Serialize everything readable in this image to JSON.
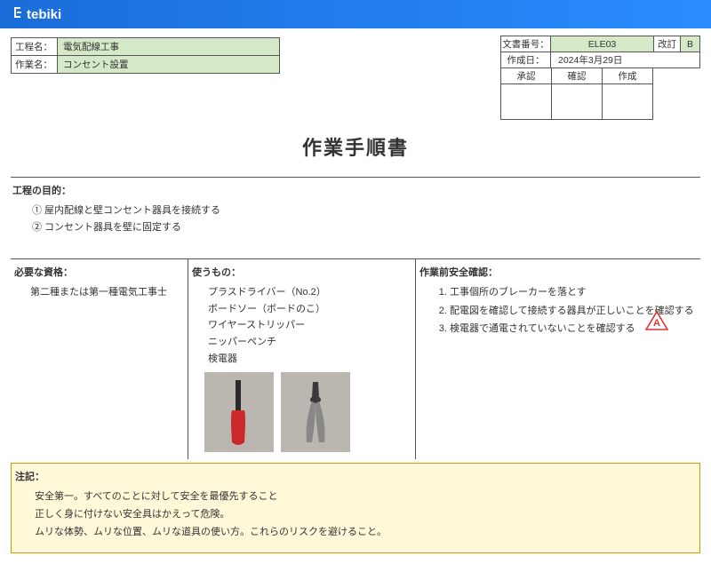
{
  "brand": "tebiki",
  "meta": {
    "doc_no_label": "文書番号：",
    "doc_no": "ELE03",
    "rev_label": "改訂",
    "rev": "B",
    "date_label": "作成日：",
    "date": "2024年3月29日",
    "approve": "承認",
    "check": "確認",
    "create": "作成"
  },
  "header": {
    "proc_label": "工程名：",
    "proc": "電気配線工事",
    "task_label": "作業名：",
    "task": "コンセント設置"
  },
  "title": "作業手順書",
  "purpose": {
    "label": "工程の目的：",
    "line1": "① 屋内配線と壁コンセント器具を接続する",
    "line2": "② コンセント器具を壁に固定する"
  },
  "qual": {
    "label": "必要な資格：",
    "text": "第二種または第一種電気工事士"
  },
  "tools": {
    "label": "使うもの：",
    "t1": "プラスドライバー（No.2）",
    "t2": "ボードソー（ボードのこ）",
    "t3": "ワイヤーストリッパー",
    "t4": "ニッパーペンチ",
    "t5": "検電器"
  },
  "safety": {
    "label": "作業前安全確認：",
    "s1": "工事個所のブレーカーを落とす",
    "s2": "配電図を確認して接続する器具が正しいことを確認する",
    "s3": "検電器で通電されていないことを確認する"
  },
  "notes": {
    "label": "注記：",
    "n1": "安全第一。すべてのことに対して安全を最優先すること",
    "n2": "正しく身に付けない安全具はかえって危険。",
    "n3": "ムリな体勢、ムリな位置、ムリな道具の使い方。これらのリスクを避けること。"
  }
}
